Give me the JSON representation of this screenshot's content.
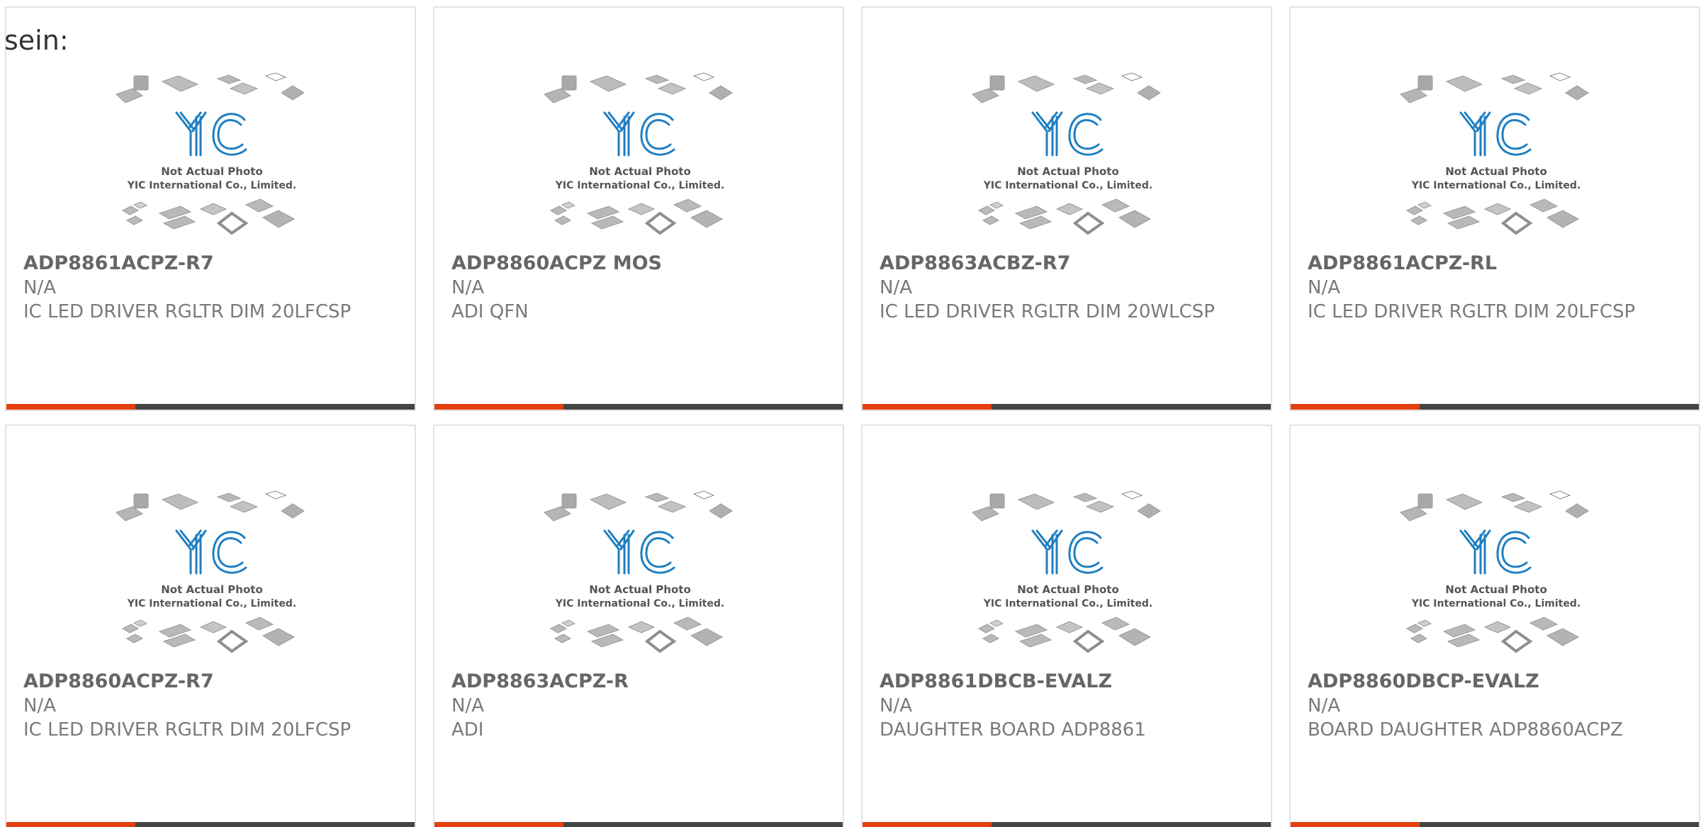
{
  "intro_text": "sein:",
  "image_caption": {
    "line1": "Not Actual Photo",
    "line2": "YIC International Co., Limited.",
    "logo": "YIC"
  },
  "colors": {
    "accent": "#e4400f",
    "bar": "#454545",
    "logo_blue": "#1f7fc1",
    "chip_gray": "#b9b9b9",
    "card_border": "#e3e3e3"
  },
  "products": [
    {
      "part_number": "ADP8861ACPZ-R7",
      "manufacturer": "N/A",
      "description": "IC LED DRIVER RGLTR DIM 20LFCSP"
    },
    {
      "part_number": "ADP8860ACPZ MOS",
      "manufacturer": "N/A",
      "description": "ADI QFN"
    },
    {
      "part_number": "ADP8863ACBZ-R7",
      "manufacturer": "N/A",
      "description": "IC LED DRIVER RGLTR DIM 20WLCSP"
    },
    {
      "part_number": "ADP8861ACPZ-RL",
      "manufacturer": "N/A",
      "description": "IC LED DRIVER RGLTR DIM 20LFCSP"
    },
    {
      "part_number": "ADP8860ACPZ-R7",
      "manufacturer": "N/A",
      "description": "IC LED DRIVER RGLTR DIM 20LFCSP"
    },
    {
      "part_number": "ADP8863ACPZ-R",
      "manufacturer": "N/A",
      "description": "ADI"
    },
    {
      "part_number": "ADP8861DBCB-EVALZ",
      "manufacturer": "N/A",
      "description": "DAUGHTER BOARD ADP8861"
    },
    {
      "part_number": "ADP8860DBCP-EVALZ",
      "manufacturer": "N/A",
      "description": "BOARD DAUGHTER ADP8860ACPZ"
    }
  ]
}
